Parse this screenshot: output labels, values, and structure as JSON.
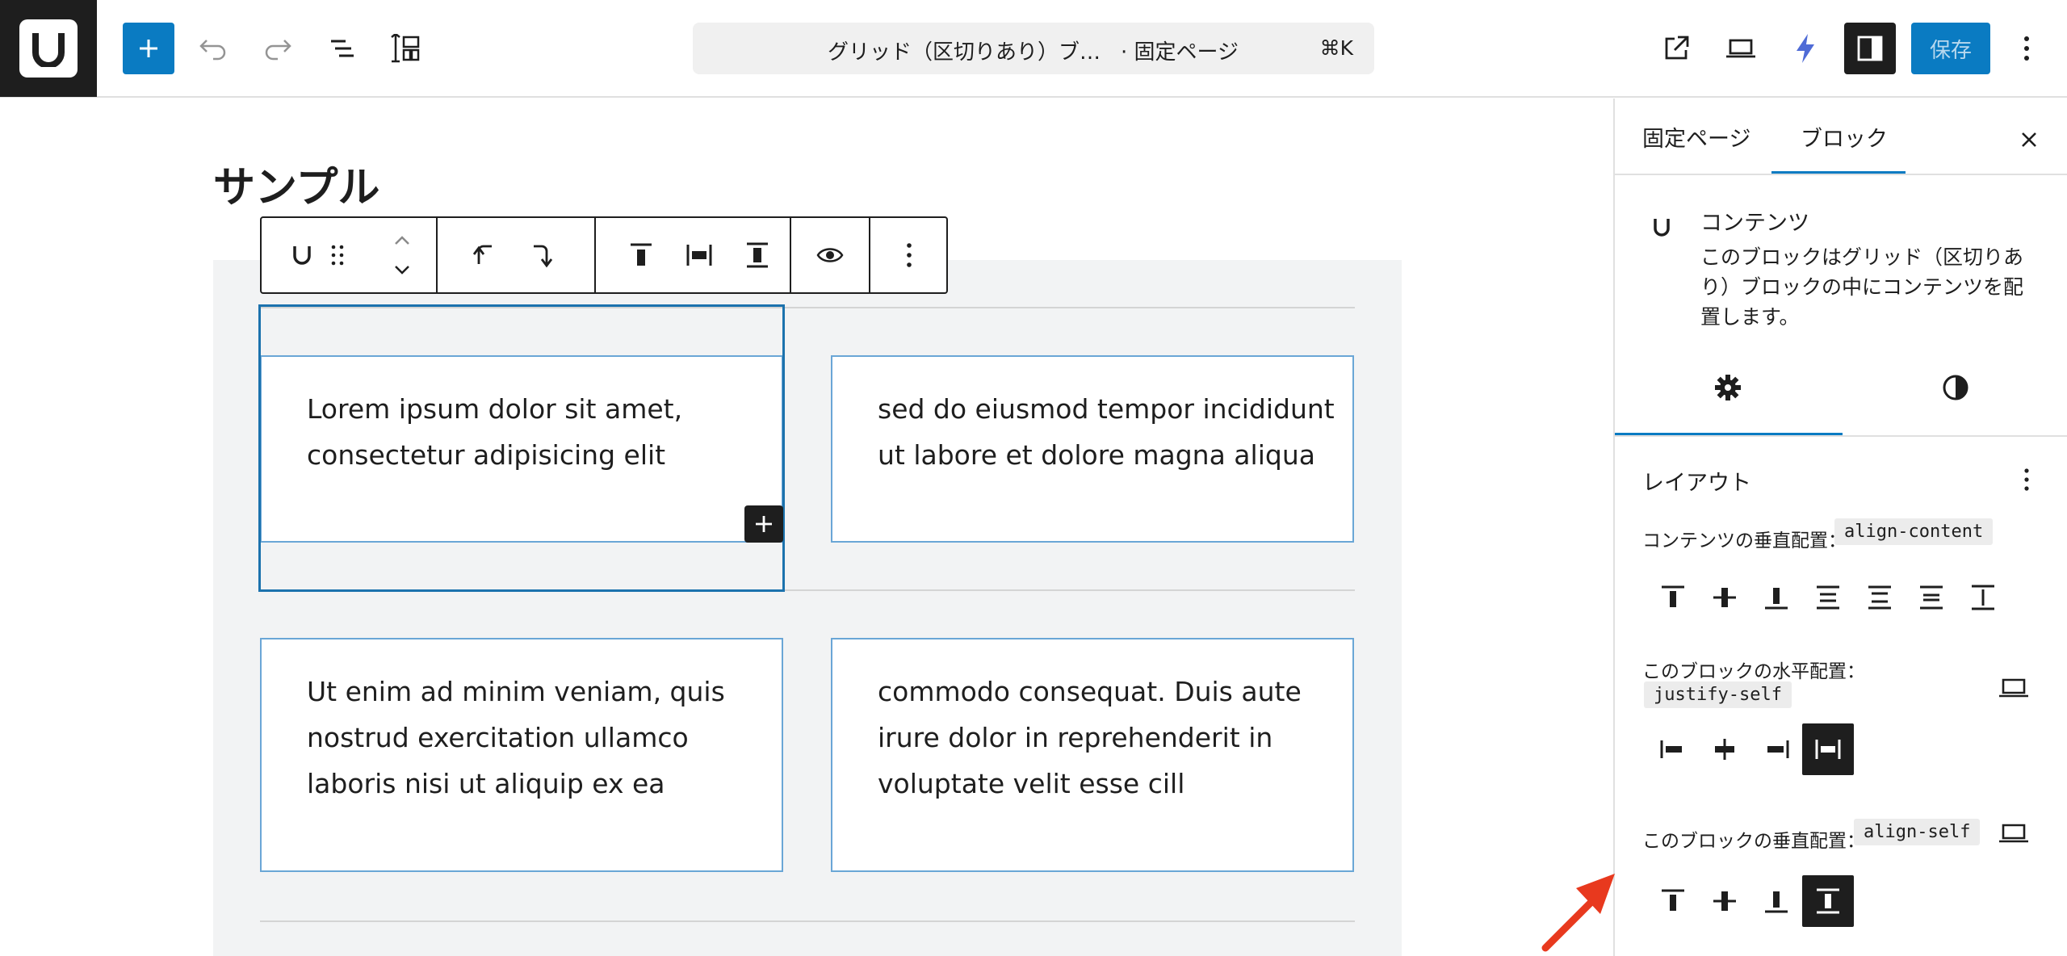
{
  "header": {
    "logo_letter": "U",
    "document_title": "グリッド（区切りあり）ブ…",
    "document_type": "· 固定ページ",
    "shortcut": "⌘K",
    "save_label": "保存",
    "icons": [
      "plus-icon",
      "undo-icon",
      "redo-icon",
      "list-view-icon",
      "block-patterns-icon",
      "external-link-icon",
      "device-preview-icon",
      "lightning-icon",
      "sidebar-toggle-icon",
      "more-vertical-icon"
    ]
  },
  "canvas": {
    "page_title": "サンプル",
    "cards": [
      {
        "lines": [
          "Lorem ipsum dolor sit amet,",
          "consectetur adipisicing elit"
        ]
      },
      {
        "lines": [
          "sed do eiusmod tempor incididunt",
          "ut labore et dolore magna aliqua"
        ]
      },
      {
        "lines": [
          "Ut enim ad minim veniam, quis",
          "nostrud exercitation ullamco",
          "laboris nisi ut aliquip ex ea"
        ]
      },
      {
        "lines": [
          "commodo consequat. Duis aute",
          "irure dolor in reprehenderit in",
          "voluptate velit esse cill"
        ]
      }
    ]
  },
  "sidebar": {
    "tabs": [
      "固定ページ",
      "ブロック"
    ],
    "active_tab": "ブロック",
    "block": {
      "name": "コンテンツ",
      "description": "このブロックはグリッド（区切りあり）ブロックの中にコンテンツを配置します。"
    },
    "panel_title": "レイアウト",
    "align_content": {
      "label": "コンテンツの垂直配置：",
      "code": "align-content"
    },
    "justify_self": {
      "label": "このブロックの水平配置：",
      "code": "justify-self"
    },
    "align_self": {
      "label": "このブロックの垂直配置：",
      "code": "align-self"
    }
  },
  "colors": {
    "accent": "#0a7bc2",
    "dark": "#1e1e1e",
    "card_border": "#6aa6d6",
    "selection": "#1c72ad",
    "annotation_arrow": "#e8391e"
  }
}
